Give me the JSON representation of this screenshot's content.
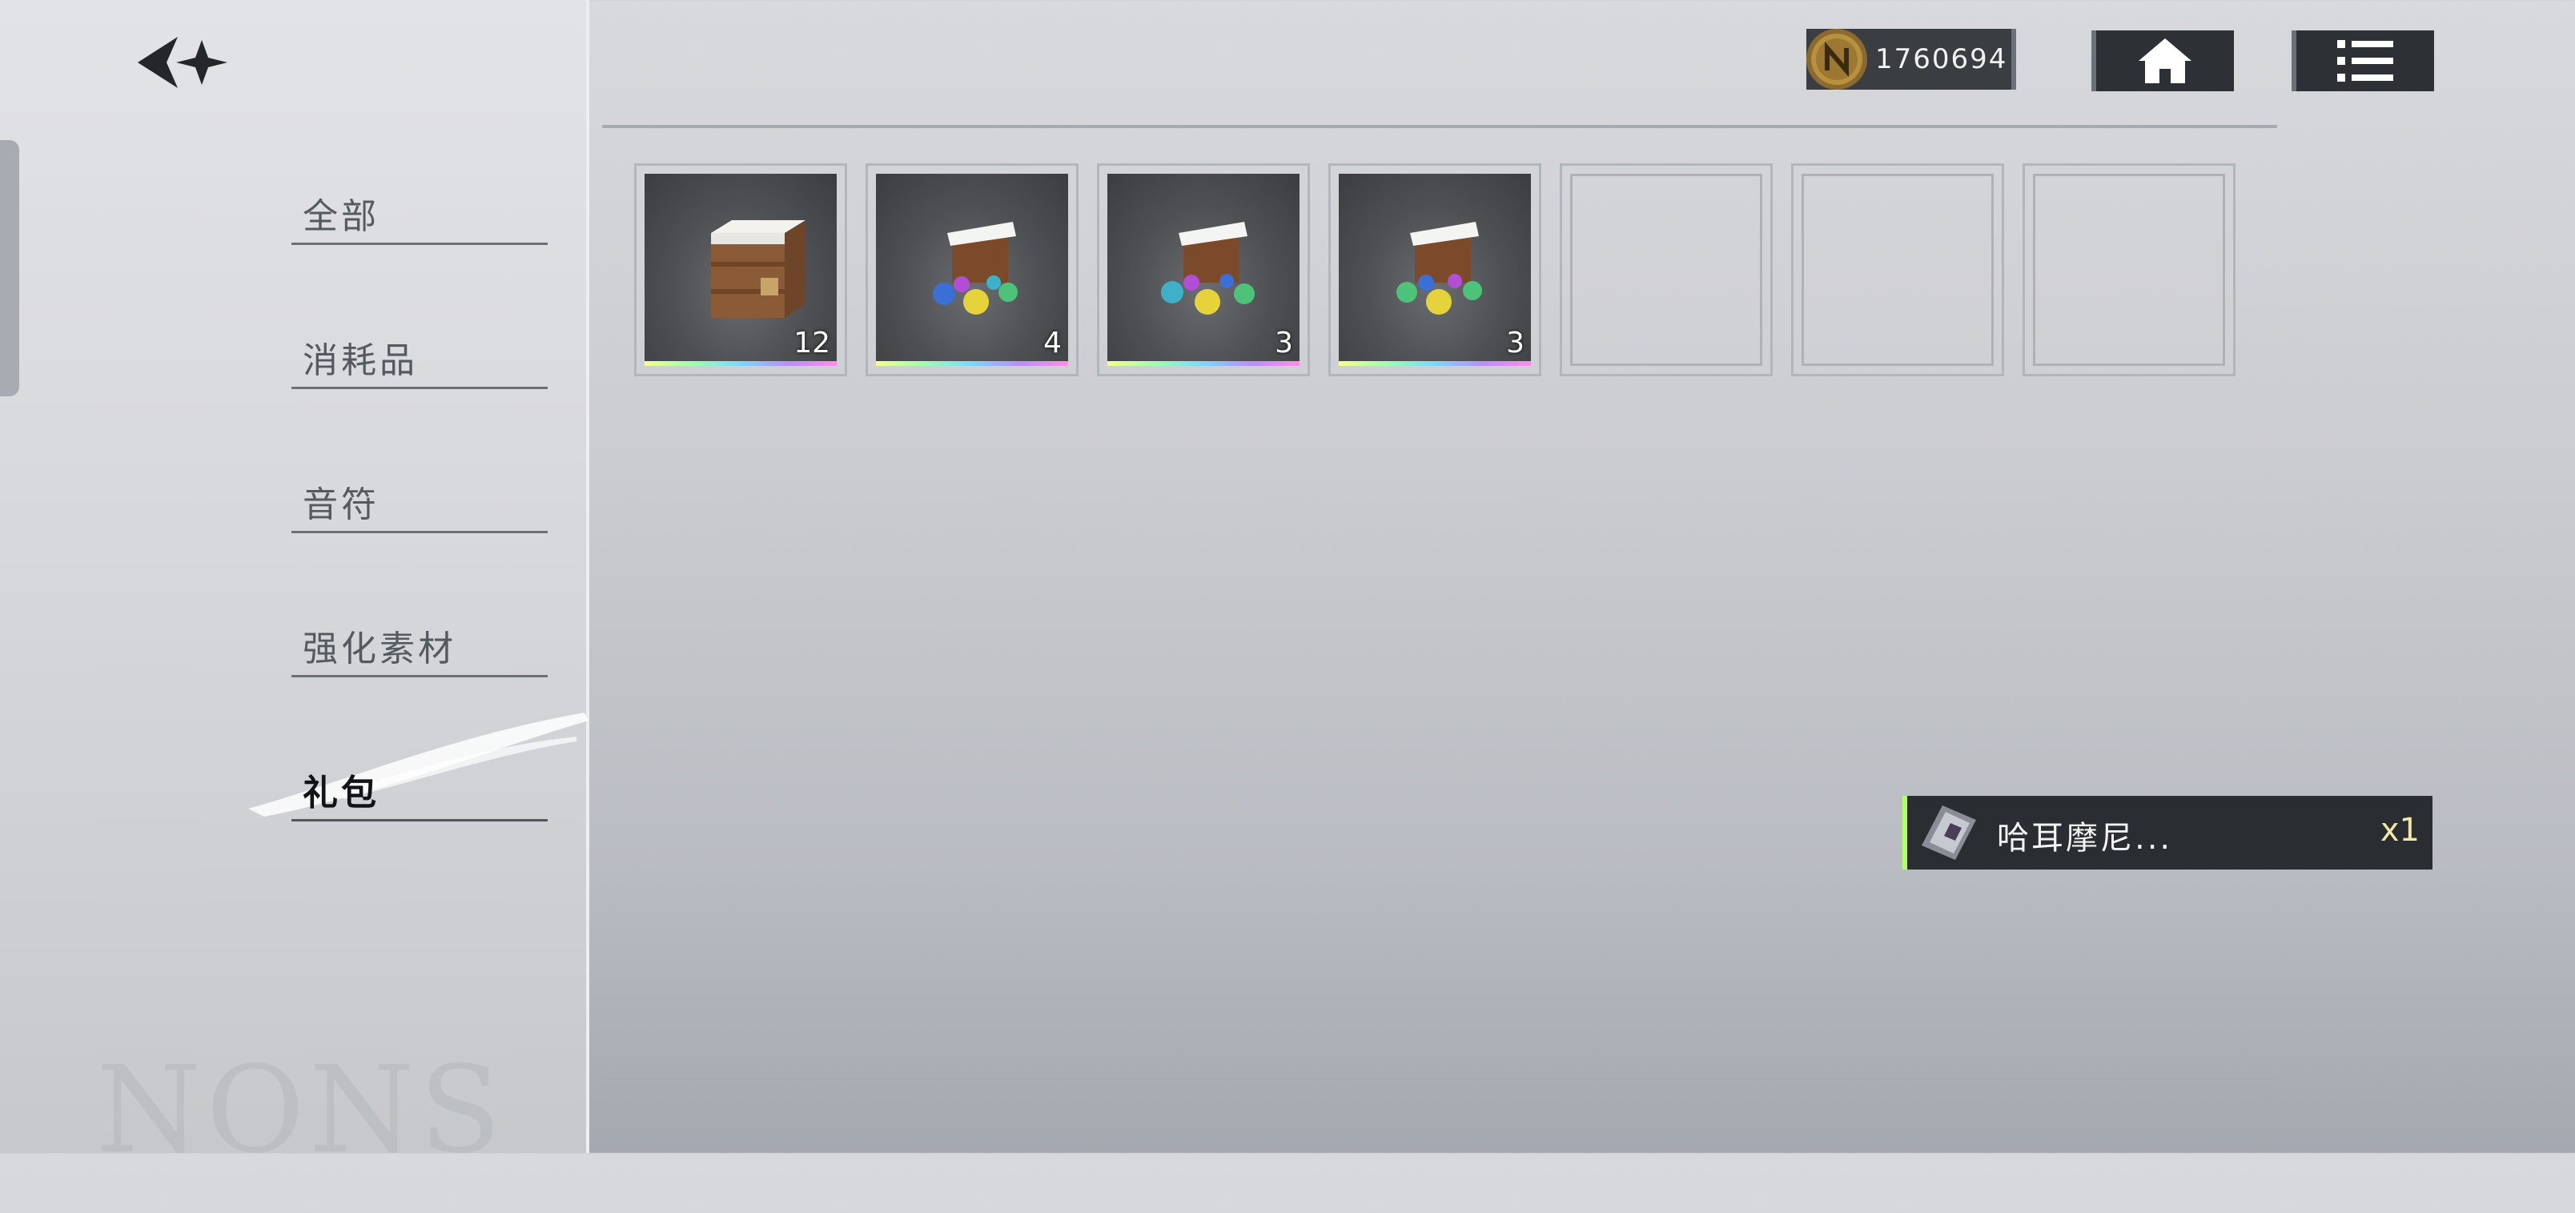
{
  "nav": {
    "back_icon": "back-arrow-icon"
  },
  "categories": [
    {
      "label": "全部",
      "active": false
    },
    {
      "label": "消耗品",
      "active": false
    },
    {
      "label": "音符",
      "active": false
    },
    {
      "label": "强化素材",
      "active": false
    },
    {
      "label": "礼包",
      "active": true
    }
  ],
  "header": {
    "currency_amount": "1760694",
    "currency_icon": "coin-icon",
    "home_icon": "home-icon",
    "menu_icon": "list-menu-icon"
  },
  "items": [
    {
      "type": "wooden-crate",
      "count": "12"
    },
    {
      "type": "gift-box-flowers",
      "count": "4"
    },
    {
      "type": "gift-box-flowers",
      "count": "3"
    },
    {
      "type": "gift-box-flowers",
      "count": "3"
    },
    {
      "type": "empty",
      "count": ""
    },
    {
      "type": "empty",
      "count": ""
    },
    {
      "type": "empty",
      "count": ""
    }
  ],
  "toast": {
    "name": "哈耳摩尼...",
    "quantity": "x1"
  },
  "decoration": {
    "watermark": "NONS"
  },
  "colors": {
    "accent_rarity": "#b3ff66",
    "panel_dark": "#2d3035"
  }
}
